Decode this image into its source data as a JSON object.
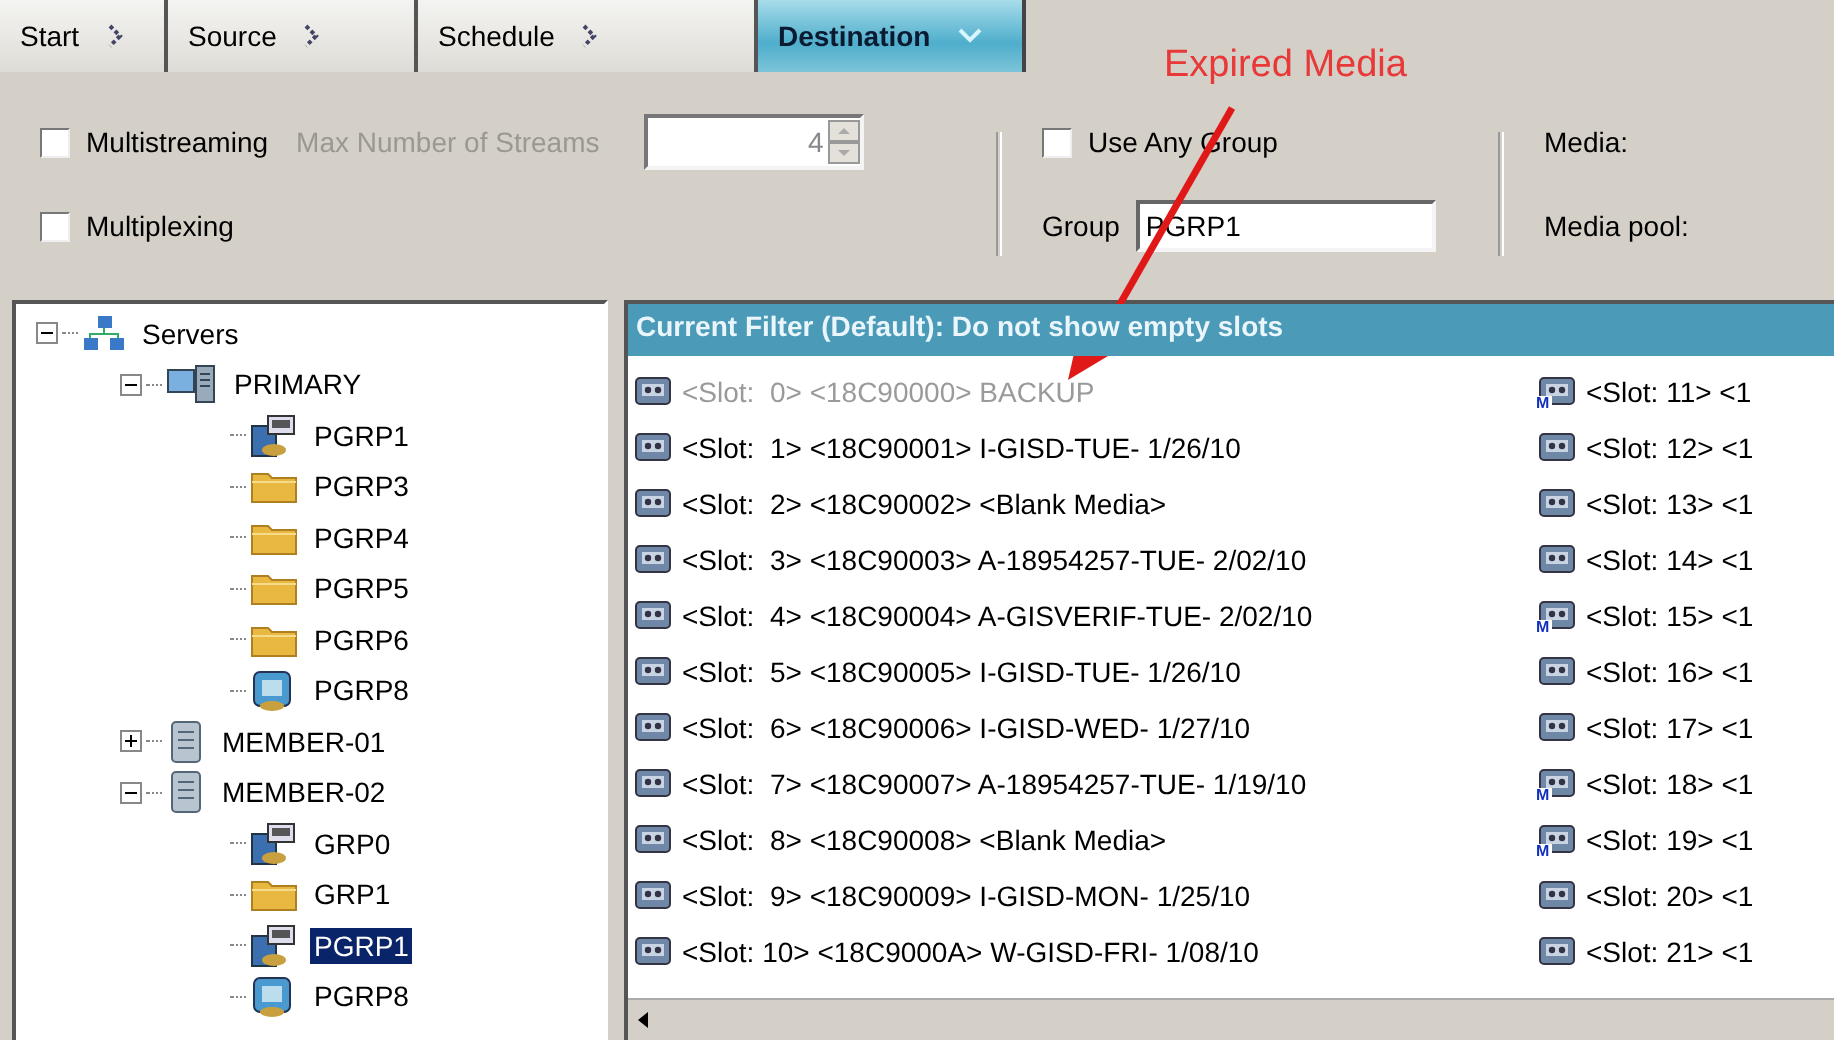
{
  "tabs": [
    {
      "label": "Start",
      "selected": false
    },
    {
      "label": "Source",
      "selected": false
    },
    {
      "label": "Schedule",
      "selected": false
    },
    {
      "label": "Destination",
      "selected": true
    }
  ],
  "options": {
    "multistreaming": {
      "label": "Multistreaming",
      "checked": false
    },
    "max_streams": {
      "label": "Max Number of Streams",
      "value": "4",
      "disabled": true
    },
    "multiplexing": {
      "label": "Multiplexing",
      "checked": false
    },
    "use_any_group": {
      "label": "Use Any Group",
      "checked": false
    },
    "group": {
      "label": "Group",
      "value": "PGRP1"
    },
    "media_label": "Media:",
    "media_pool_label": "Media pool:"
  },
  "annotation": {
    "label": "Expired Media"
  },
  "tree": [
    {
      "label": "Servers",
      "kind": "network",
      "expanded": true,
      "selected": false,
      "children": [
        {
          "label": "PRIMARY",
          "kind": "server-pc",
          "expanded": true,
          "selected": false,
          "children": [
            {
              "label": "PGRP1",
              "kind": "computer",
              "selected": false
            },
            {
              "label": "PGRP3",
              "kind": "folder",
              "selected": false
            },
            {
              "label": "PGRP4",
              "kind": "folder",
              "selected": false
            },
            {
              "label": "PGRP5",
              "kind": "folder",
              "selected": false
            },
            {
              "label": "PGRP6",
              "kind": "folder",
              "selected": false
            },
            {
              "label": "PGRP8",
              "kind": "library",
              "selected": false
            }
          ]
        },
        {
          "label": "MEMBER-01",
          "kind": "server",
          "expanded": false,
          "selected": false
        },
        {
          "label": "MEMBER-02",
          "kind": "server",
          "expanded": true,
          "selected": false,
          "children": [
            {
              "label": "GRP0",
              "kind": "computer",
              "selected": false
            },
            {
              "label": "GRP1",
              "kind": "folder",
              "selected": false
            },
            {
              "label": "PGRP1",
              "kind": "computer",
              "selected": true
            },
            {
              "label": "PGRP8",
              "kind": "library",
              "selected": false
            }
          ]
        }
      ]
    }
  ],
  "slots": {
    "filter": "Current Filter (Default):  Do not show empty slots",
    "columns": [
      [
        {
          "text": "<Slot:  0> <18C90000> BACKUP",
          "greyed": true
        },
        {
          "text": "<Slot:  1> <18C90001> I-GISD-TUE- 1/26/10",
          "greyed": false
        },
        {
          "text": "<Slot:  2> <18C90002> <Blank Media>",
          "greyed": false
        },
        {
          "text": "<Slot:  3> <18C90003> A-18954257-TUE- 2/02/10",
          "greyed": false
        },
        {
          "text": "<Slot:  4> <18C90004> A-GISVERIF-TUE- 2/02/10",
          "greyed": false
        },
        {
          "text": "<Slot:  5> <18C90005> I-GISD-TUE- 1/26/10",
          "greyed": false
        },
        {
          "text": "<Slot:  6> <18C90006> I-GISD-WED- 1/27/10",
          "greyed": false
        },
        {
          "text": "<Slot:  7> <18C90007> A-18954257-TUE- 1/19/10",
          "greyed": false
        },
        {
          "text": "<Slot:  8> <18C90008> <Blank Media>",
          "greyed": false
        },
        {
          "text": "<Slot:  9> <18C90009> I-GISD-MON- 1/25/10",
          "greyed": false
        },
        {
          "text": "<Slot: 10> <18C9000A> W-GISD-FRI- 1/08/10",
          "greyed": false
        }
      ],
      [
        {
          "text": "<Slot: 11> <1",
          "greyed": false,
          "badge": "M"
        },
        {
          "text": "<Slot: 12> <1",
          "greyed": false
        },
        {
          "text": "<Slot: 13> <1",
          "greyed": false
        },
        {
          "text": "<Slot: 14> <1",
          "greyed": false
        },
        {
          "text": "<Slot: 15> <1",
          "greyed": false,
          "badge": "M"
        },
        {
          "text": "<Slot: 16> <1",
          "greyed": false
        },
        {
          "text": "<Slot: 17> <1",
          "greyed": false
        },
        {
          "text": "<Slot: 18> <1",
          "greyed": false,
          "badge": "M"
        },
        {
          "text": "<Slot: 19> <1",
          "greyed": false,
          "badge": "M"
        },
        {
          "text": "<Slot: 20> <1",
          "greyed": false
        },
        {
          "text": "<Slot: 21> <1",
          "greyed": false
        }
      ]
    ]
  }
}
